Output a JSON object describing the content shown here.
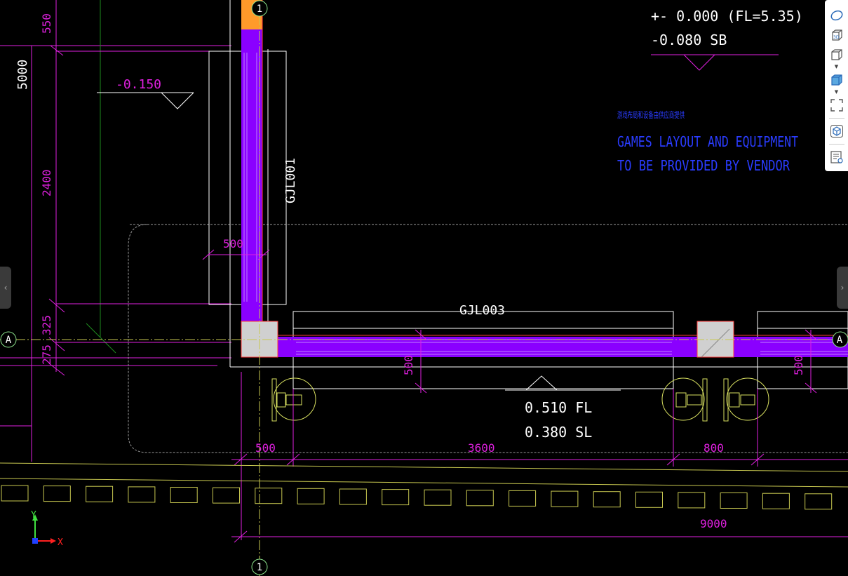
{
  "colors": {
    "background": "#000000",
    "dimension": "#e020e0",
    "wall_fill": "#8a00ff",
    "white_line": "#ffffff",
    "blue_note": "#2a3cff",
    "grid_green": "#8ae08a",
    "column_fill": "#d0d0d0",
    "orange_fill": "#ff9a2a",
    "yellow_line": "#d8d840"
  },
  "levels": {
    "ffl": "+- 0.000 (FL=5.35)",
    "sb": "-0.080 SB",
    "left_level": "-0.150",
    "fl_value": "0.510 FL",
    "sl_value": "0.380 SL"
  },
  "notes": {
    "chinese_garbled": "游戏布局和设备由供应商提供",
    "line1": "GAMES LAYOUT AND EQUIPMENT",
    "line2": "TO BE PROVIDED BY VENDOR"
  },
  "beams": {
    "vertical": "GJL001",
    "horizontal": "GJL003"
  },
  "dimensions": {
    "top_550": "550",
    "total_5000": "5000",
    "d2400": "2400",
    "d325": "325",
    "d275": "275",
    "beam_width_500": "500",
    "beam_500_b": "500",
    "beam_500_c": "500",
    "bottom_500": "500",
    "bottom_3600": "3600",
    "bottom_800": "800",
    "bottom_9000": "9000"
  },
  "grid_bubbles": {
    "top_1": "1",
    "bottom_1": "1",
    "left_a": "A",
    "right_a": "A"
  },
  "ucs": {
    "x_label": "X",
    "y_label": "Y"
  },
  "toolbar": {
    "icons": [
      "orbit-icon",
      "3d-view-icon",
      "box-view-icon",
      "shaded-box-icon",
      "fullscreen-icon",
      "viewcube-icon",
      "properties-icon"
    ],
    "label_3d": "3D"
  },
  "nav": {
    "left_arrow": "‹",
    "right_arrow": "›"
  }
}
